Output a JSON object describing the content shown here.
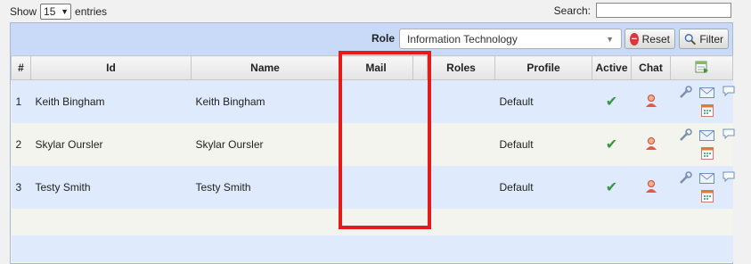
{
  "length_menu": {
    "before": "Show",
    "value": "15",
    "after": "entries"
  },
  "search": {
    "label": "Search:",
    "value": ""
  },
  "filter": {
    "role_label": "Role",
    "role_value": "Information Technology",
    "reset_label": "Reset",
    "filter_label": "Filter"
  },
  "columns": [
    "#",
    "Id",
    "Name",
    "Mail",
    "Roles",
    "Profile",
    "Active",
    "Chat"
  ],
  "rows": [
    {
      "num": "1",
      "id": "Keith Bingham",
      "name": "Keith Bingham",
      "mail": "",
      "roles": "",
      "profile": "Default"
    },
    {
      "num": "2",
      "id": "Skylar Oursler",
      "name": "Skylar Oursler",
      "mail": "",
      "roles": "",
      "profile": "Default"
    },
    {
      "num": "3",
      "id": "Testy Smith",
      "name": "Testy Smith",
      "mail": "",
      "roles": "",
      "profile": "Default"
    }
  ],
  "icons": {
    "active": "check-icon",
    "chat": "person-icon",
    "edit": "wrench-icon",
    "mail": "envelope-icon",
    "comment": "speech-bubble-icon",
    "calendar": "calendar-icon",
    "export": "export-icon"
  },
  "colors": {
    "highlight": "#e21b1b",
    "toolbar": "#c9daf8",
    "row_blue": "#dfeafc",
    "row_alt": "#f4f4ee",
    "check": "#2f9a39"
  }
}
